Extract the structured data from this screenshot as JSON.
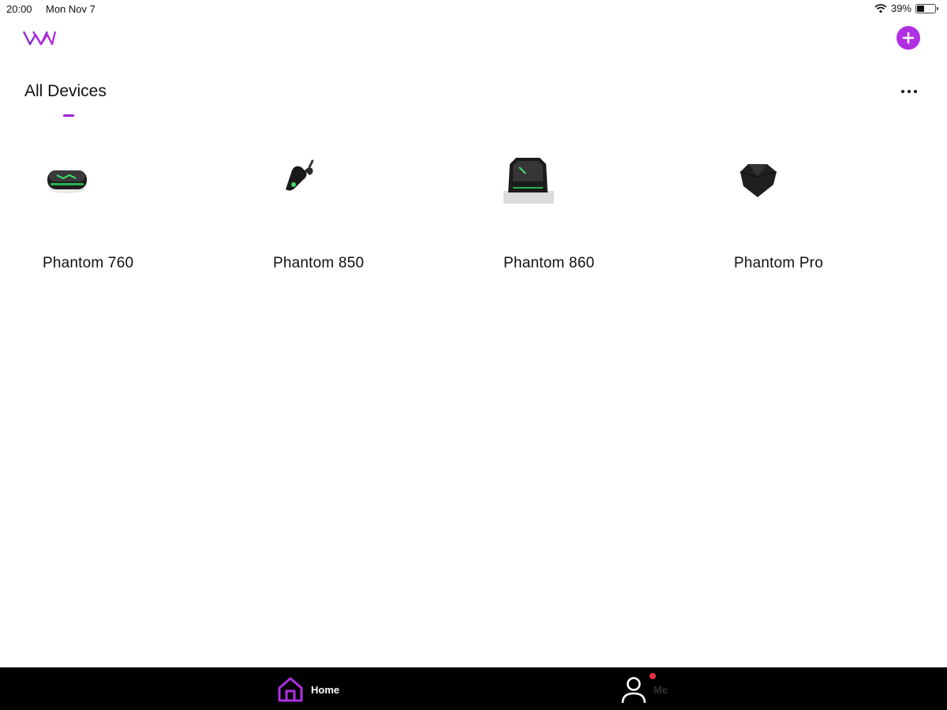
{
  "status_bar": {
    "time": "20:00",
    "date": "Mon Nov 7",
    "battery_percent": "39%",
    "battery_level": 0.39
  },
  "header": {
    "title": "All Devices",
    "accent_color": "#b02fe3"
  },
  "devices": [
    {
      "name": "Phantom 760"
    },
    {
      "name": "Phantom 850"
    },
    {
      "name": "Phantom 860"
    },
    {
      "name": "Phantom Pro"
    }
  ],
  "tab_bar": {
    "home_label": "Home",
    "me_label": "Me",
    "active_tab": "Home"
  },
  "icons": {
    "logo": "brand-logo-icon",
    "add": "plus-circle-icon",
    "more": "more-horizontal-icon",
    "home": "home-icon",
    "me": "person-icon",
    "wifi": "wifi-icon",
    "battery": "battery-icon"
  }
}
